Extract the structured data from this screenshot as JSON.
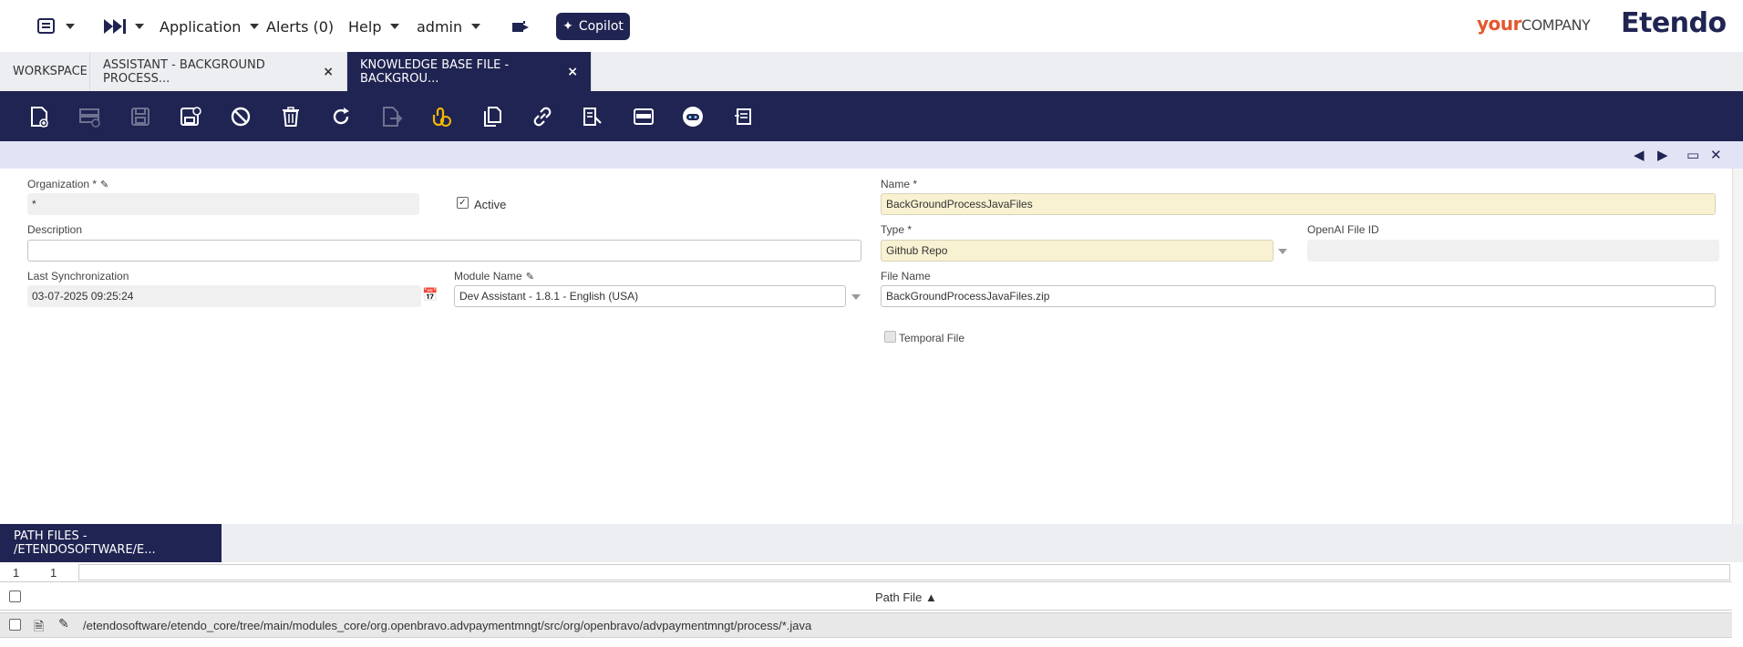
{
  "navbar": {
    "application": "Application",
    "alerts": "Alerts (0)",
    "help": "Help",
    "user": "admin",
    "copilot": "Copilot",
    "logo_your": "your",
    "logo_company": "COMPANY",
    "logo_etendo": "Etendo"
  },
  "tabs": [
    {
      "label": "WORKSPACE"
    },
    {
      "label": "ASSISTANT - BACKGROUND PROCESS..."
    },
    {
      "label": "KNOWLEDGE BASE FILE - BACKGROU..."
    }
  ],
  "toolbar_icons": [
    "new-document-icon",
    "new-row-icon",
    "save-icon",
    "save-close-icon",
    "cancel-icon",
    "delete-icon",
    "refresh-icon",
    "export-icon",
    "attachment-icon",
    "copy-record-icon",
    "link-icon",
    "audit-icon",
    "grid-view-icon",
    "copilot-bot-icon",
    "report-icon"
  ],
  "form": {
    "organization_label": "Organization *",
    "organization_value": "*",
    "active_label": "Active",
    "active_checked": true,
    "name_label": "Name *",
    "name_value": "BackGroundProcessJavaFiles",
    "description_label": "Description",
    "description_value": "",
    "type_label": "Type *",
    "type_value": "Github Repo",
    "openai_file_id_label": "OpenAI File ID",
    "openai_file_id_value": "",
    "last_sync_label": "Last Synchronization",
    "last_sync_value": "03-07-2025 09:25:24",
    "module_name_label": "Module Name",
    "module_name_value": "Dev Assistant - 1.8.1 - English (USA)",
    "file_name_label": "File Name",
    "file_name_value": "BackGroundProcessJavaFiles.zip",
    "temporal_file_label": "Temporal File",
    "temporal_file_checked": false
  },
  "subtab": {
    "label": "PATH FILES - /ETENDOSOFTWARE/E..."
  },
  "grid": {
    "count_left": "1",
    "count_right": "1",
    "column_header": "Path File",
    "rows": [
      {
        "path": "/etendosoftware/etendo_core/tree/main/modules_core/org.openbravo.advpaymentmngt/src/org/openbravo/advpaymentmngt/process/*.java"
      }
    ]
  },
  "colors": {
    "brand_navy": "#202452",
    "required_field": "#f8f1d2",
    "accent_orange": "#e4572e"
  }
}
